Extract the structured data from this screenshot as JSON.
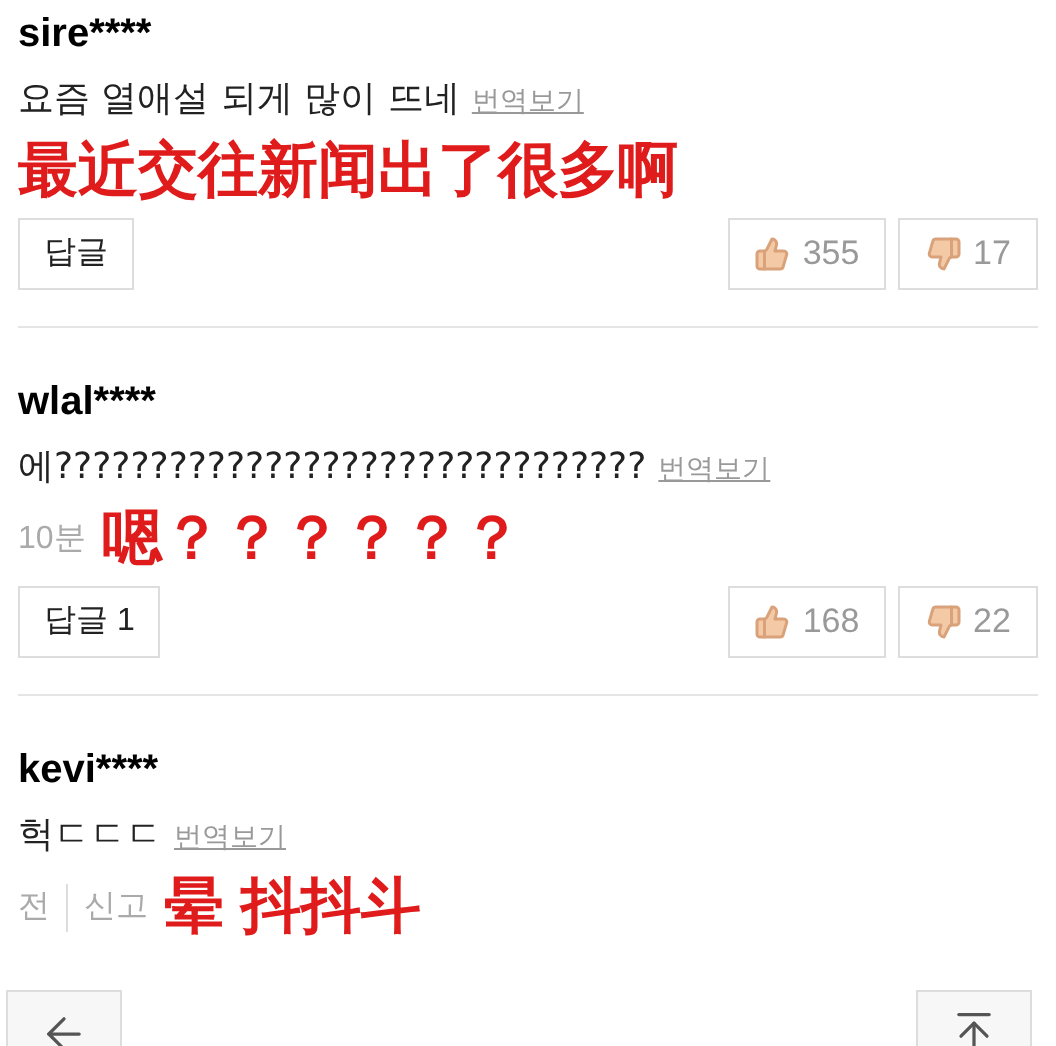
{
  "comments": [
    {
      "username": "sire****",
      "text": "요즘 열애설 되게 많이 뜨네",
      "translate_link": "번역보기",
      "caption": "最近交往新闻出了很多啊",
      "reply_button": "답글",
      "likes": "355",
      "dislikes": "17"
    },
    {
      "username": "wlal****",
      "text": "에???????????????????????????????",
      "translate_link": "번역보기",
      "meta": [
        "10분"
      ],
      "caption": "嗯？？？？？？",
      "reply_button": "답글 1",
      "likes": "168",
      "dislikes": "22"
    },
    {
      "username": "kevi****",
      "text": "헉ㄷㄷㄷ",
      "translate_link": "번역보기",
      "meta": [
        "전",
        "신고"
      ],
      "caption": "晕 抖抖斗"
    }
  ]
}
